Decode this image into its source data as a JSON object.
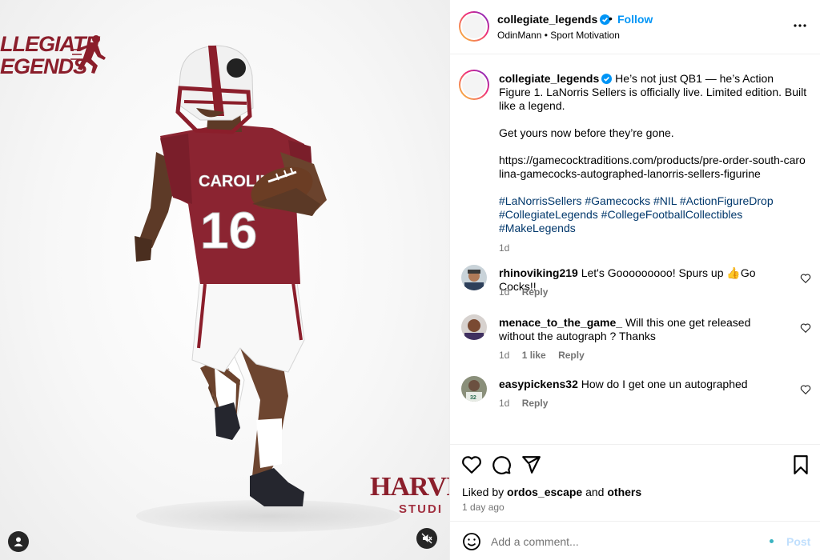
{
  "media": {
    "brand_logo": {
      "line1": "LLEGIATE",
      "line2": "EGENDS"
    },
    "studio_logo": {
      "line1": "HARVIN",
      "line2": "STUDI"
    },
    "jersey": {
      "team": "CAROLINA",
      "number": "16"
    },
    "colors": {
      "garnet": "#8b1e2b",
      "white": "#ffffff"
    }
  },
  "header": {
    "username": "collegiate_legends",
    "separator": "•",
    "follow_label": "Follow",
    "subtitle": "OdinMann • Sport Motivation",
    "more_icon": "more-horizontal-icon"
  },
  "caption": {
    "username": "collegiate_legends",
    "text1": "He’s not just QB1 — he’s Action Figure 1. LaNorris Sellers is officially live. Limited edition. Built like a legend.",
    "text2": "Get yours now before they’re gone.",
    "link": "https://gamecocktraditions.com/products/pre-order-south-carolina-gamecocks-autographed-lanorris-sellers-figurine",
    "hashtags": "#LaNorrisSellers #Gamecocks #NIL #ActionFigureDrop #CollegiateLegends #CollegeFootballCollectibles #MakeLegends",
    "time": "1d"
  },
  "comments": [
    {
      "username": "rhinoviking219",
      "text": "Let's Gooooooooo! Spurs up 👍Go Cocks!!",
      "time": "1d",
      "likes": "",
      "reply": "Reply"
    },
    {
      "username": "menace_to_the_game_",
      "text": "Will this one get released without the autograph ? Thanks",
      "time": "1d",
      "likes": "1 like",
      "reply": "Reply"
    },
    {
      "username": "easypickens32",
      "text": "How do I get one un autographed",
      "time": "1d",
      "likes": "",
      "reply": "Reply"
    }
  ],
  "actions": {
    "liked_prefix": "Liked by",
    "liked_user": "ordos_escape",
    "liked_and": "and",
    "liked_others": "others",
    "posted_ago": "1 day ago"
  },
  "add_comment": {
    "placeholder": "Add a comment...",
    "post_label": "Post"
  },
  "colors": {
    "accent": "#0095f6",
    "hashtag": "#00376b",
    "muted": "#737373"
  }
}
